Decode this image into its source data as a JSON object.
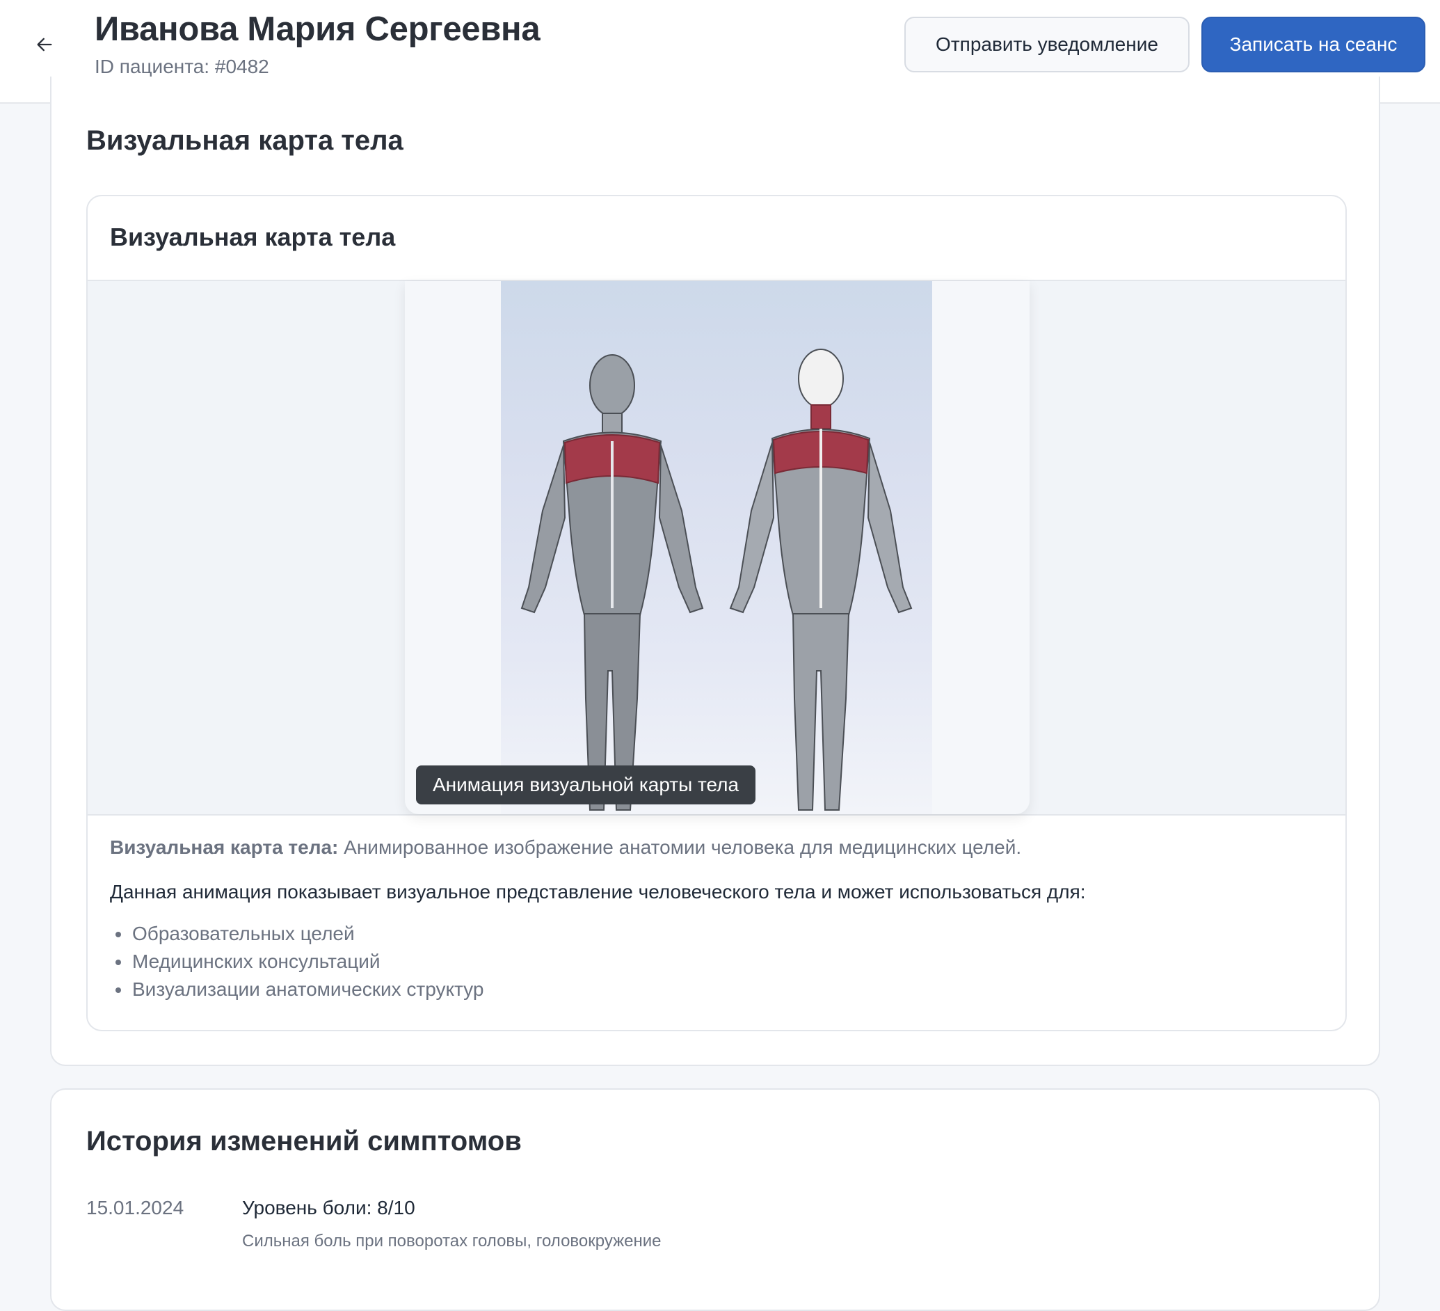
{
  "header": {
    "title": "Иванова Мария Сергеевна",
    "patient_id": "ID пациента: #0482",
    "notify_button": "Отправить уведомление",
    "schedule_button": "Записать на сеанс"
  },
  "body_map": {
    "section_title": "Визуальная карта тела",
    "card_title": "Визуальная карта тела",
    "caption": "Анимация визуальной карты тела",
    "desc_label": "Визуальная карта тела:",
    "desc_text": "Анимированное изображение анатомии человека для медицинских целей.",
    "uses_intro": "Данная анимация показывает визуальное представление человеческого тела и может использоваться для:",
    "uses": [
      "Образовательных целей",
      "Медицинских консультаций",
      "Визуализации анатомических структур"
    ]
  },
  "history": {
    "section_title": "История изменений симптомов",
    "entries": [
      {
        "date": "15.01.2024",
        "title": "Уровень боли: 8/10",
        "note": "Сильная боль при поворотах головы, головокружение"
      }
    ]
  },
  "colors": {
    "primary": "#2f66c2",
    "highlight": "#a33a4a"
  }
}
